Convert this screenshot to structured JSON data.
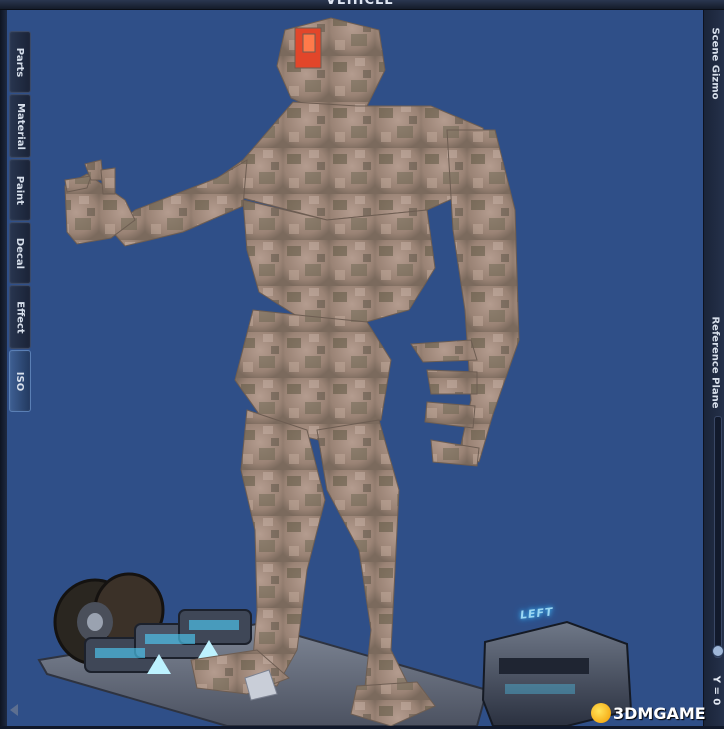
{
  "window": {
    "title": "VEHICLE"
  },
  "left_tabs": [
    {
      "label": "Parts",
      "active": false
    },
    {
      "label": "Material",
      "active": false
    },
    {
      "label": "Paint",
      "active": false
    },
    {
      "label": "Decal",
      "active": false
    },
    {
      "label": "Effect",
      "active": false
    },
    {
      "label": "ISO",
      "active": true
    }
  ],
  "right_panel": {
    "scene_gizmo": "Scene Gizmo",
    "reference_plane": "Reference Plane",
    "y_readout": "Y = 0"
  },
  "viewport": {
    "orientation_label": "LEFT"
  },
  "watermark": {
    "text": "3DMGAME"
  },
  "colors": {
    "viewport_bg": "#2f4f88",
    "frame": "#1a2438",
    "skin": "#a28b7e",
    "skin_shadow": "#5e5744",
    "accent_red": "#e2462a",
    "glow_blue": "#4fd3ff"
  },
  "icons": {
    "nav_arrow": "chevron-left-icon",
    "watermark_logo": "3dm-logo-icon"
  }
}
